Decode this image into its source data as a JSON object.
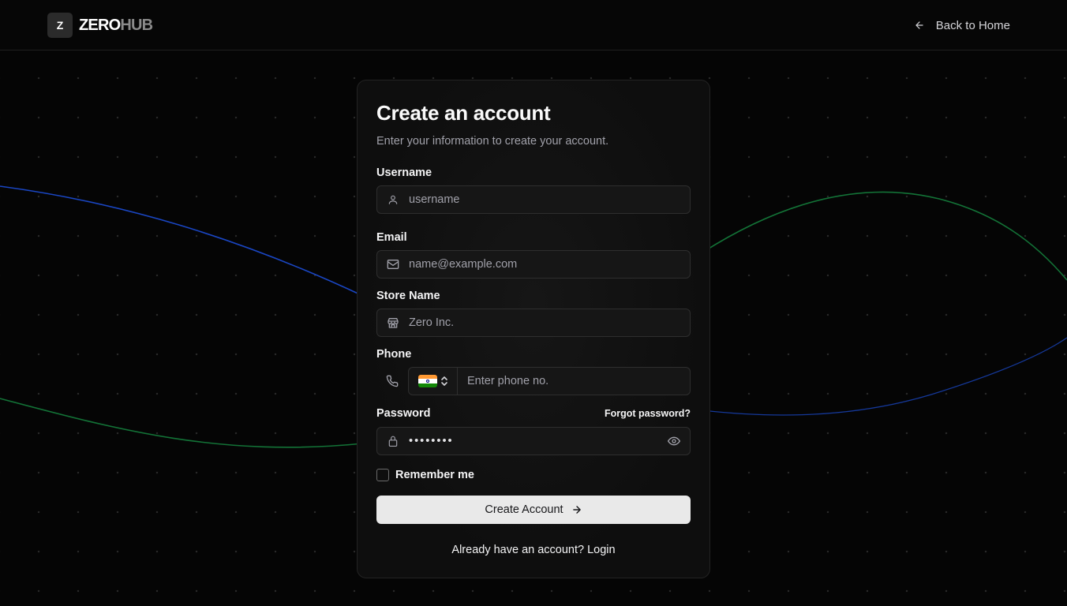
{
  "brand": {
    "mark": "Z",
    "name_primary": "ZERO",
    "name_secondary": "HUB"
  },
  "header": {
    "back_label": "Back to Home"
  },
  "form": {
    "title": "Create an account",
    "subtitle": "Enter your information to create your account.",
    "username": {
      "label": "Username",
      "placeholder": "username"
    },
    "email": {
      "label": "Email",
      "placeholder": "name@example.com"
    },
    "store": {
      "label": "Store Name",
      "placeholder": "Zero Inc."
    },
    "phone": {
      "label": "Phone",
      "placeholder": "Enter phone no.",
      "country": "India"
    },
    "password": {
      "label": "Password",
      "value": "••••••••",
      "forgot_label": "Forgot password?"
    },
    "remember_label": "Remember me",
    "submit_label": "Create Account",
    "login_prompt": "Already have an account?",
    "login_link": "Login"
  },
  "colors": {
    "background": "#050505",
    "card": "#0e0e0e",
    "accent_blue": "#1d4ed8",
    "accent_green": "#15803d",
    "button": "#e9e9e9"
  },
  "icons": [
    "user-icon",
    "mail-icon",
    "store-icon",
    "phone-icon",
    "lock-icon",
    "eye-icon",
    "arrow-left-icon",
    "arrow-right-icon",
    "chevron-up-down-icon"
  ]
}
